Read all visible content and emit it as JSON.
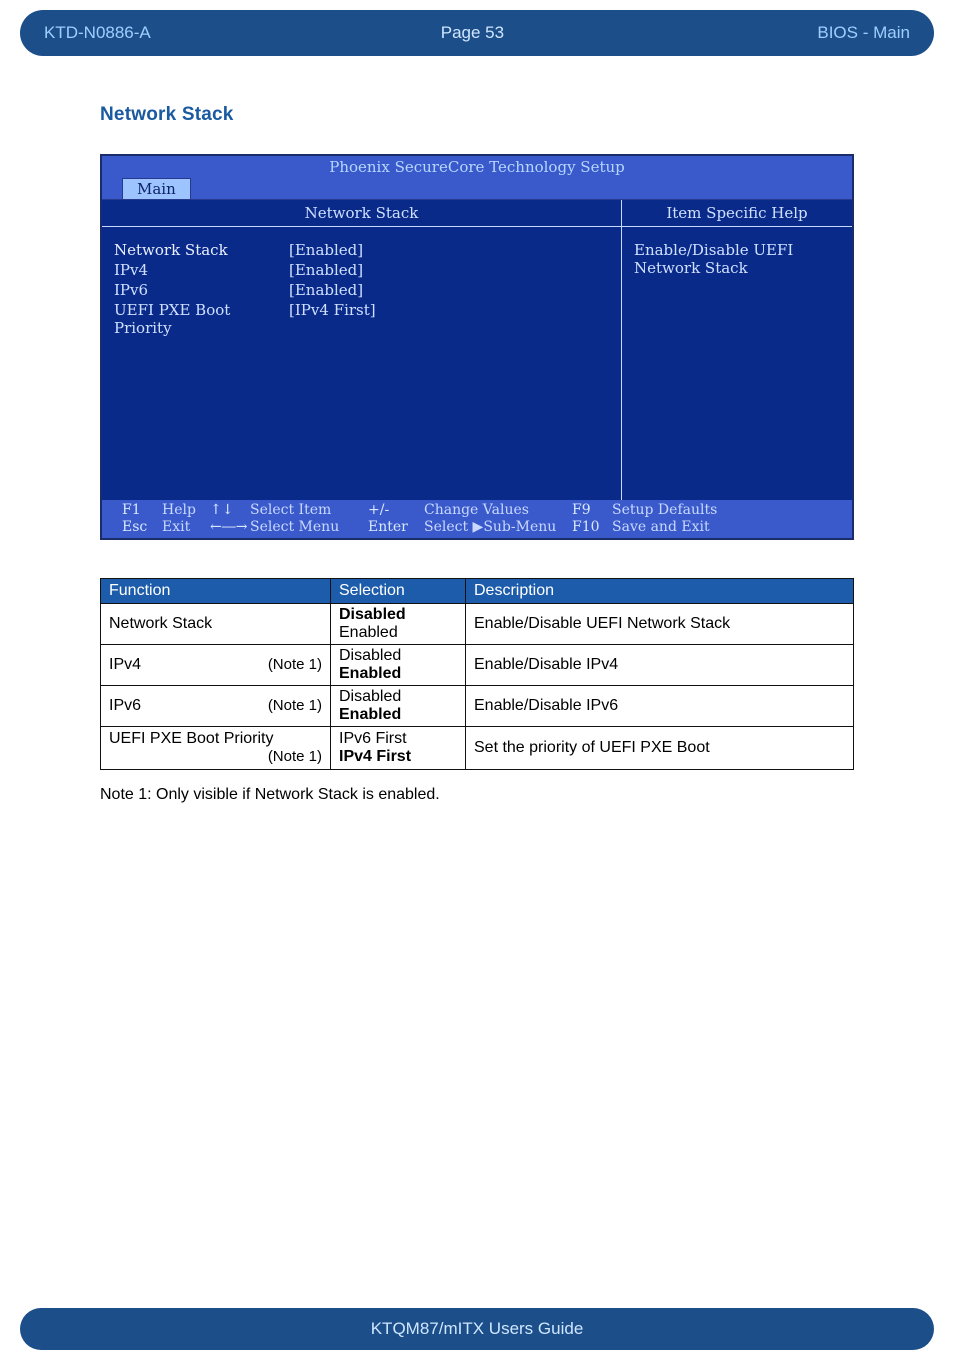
{
  "header": {
    "doc_id": "KTD-N0886-A",
    "page_label": "Page 53",
    "section_label": "BIOS  - Main"
  },
  "section_heading": "Network Stack",
  "bios": {
    "title": "Phoenix SecureCore Technology Setup",
    "tab": "Main",
    "left_heading": "Network Stack",
    "right_heading": "Item Specific Help",
    "help_text": "Enable/Disable UEFI Network Stack",
    "items": [
      {
        "label": "Network Stack",
        "value": "[Enabled]",
        "hi": true
      },
      {
        "label": "IPv4",
        "value": "[Enabled]"
      },
      {
        "label": "IPv6",
        "value": "[Enabled]"
      },
      {
        "label": "UEFI PXE Boot Priority",
        "value": "[IPv4 First]"
      }
    ],
    "footer": {
      "r1": {
        "k": "F1",
        "a": "Help",
        "sym": "↑↓",
        "act": "Select Item",
        "k2": "+/-",
        "act2": "Change Values",
        "k3": "F9",
        "act3": "Setup Defaults"
      },
      "r2": {
        "k": "Esc",
        "a": "Exit",
        "sym": "←―→",
        "act": "Select Menu",
        "k2": "Enter",
        "act2": "Select ▶Sub-Menu",
        "k3": "F10",
        "act3": "Save and Exit"
      }
    }
  },
  "table": {
    "headers": {
      "fn": "Function",
      "sel": "Selection",
      "desc": "Description"
    },
    "rows": [
      {
        "fn": "Network Stack",
        "note": "",
        "opts": [
          "Disabled",
          "Enabled"
        ],
        "bold": 0,
        "desc": "Enable/Disable UEFI Network Stack"
      },
      {
        "fn": "IPv4",
        "note": "(Note 1)",
        "opts": [
          "Disabled",
          "Enabled"
        ],
        "bold": 1,
        "desc": "Enable/Disable IPv4"
      },
      {
        "fn": "IPv6",
        "note": "(Note 1)",
        "opts": [
          "Disabled",
          "Enabled"
        ],
        "bold": 1,
        "desc": "Enable/Disable IPv6"
      },
      {
        "fn": "UEFI PXE Boot Priority",
        "note": "(Note 1)",
        "opts": [
          "IPv6 First",
          "IPv4 First"
        ],
        "bold": 1,
        "desc": "Set the priority of UEFI PXE Boot"
      }
    ]
  },
  "note_text": "Note 1: Only visible if Network Stack is enabled.",
  "footer_text": "KTQM87/mITX Users Guide"
}
